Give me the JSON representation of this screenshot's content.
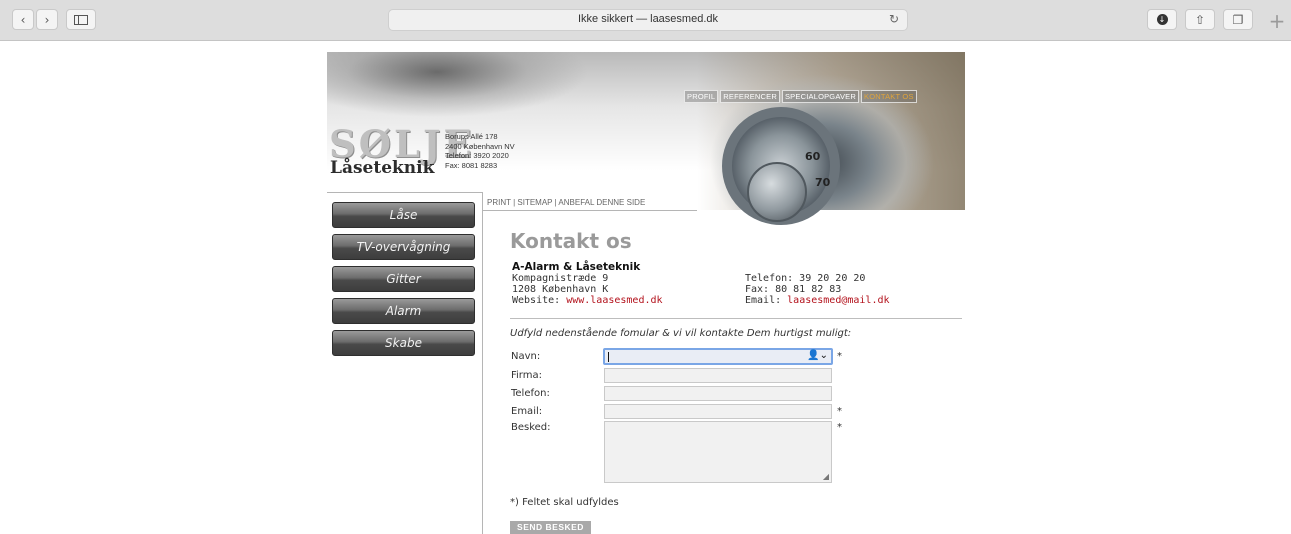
{
  "browser": {
    "address": "Ikke sikkert — laasesmed.dk"
  },
  "topnav": {
    "items": [
      "PROFIL",
      "REFERENCER",
      "SPECIALOPGAVER",
      "KONTAKT OS"
    ],
    "active_index": 3,
    "active_color": "#e0a43a"
  },
  "logo": {
    "line1": "SØLJE",
    "line2": "Låseteknik"
  },
  "company_address": {
    "line1": "Borups Allé 178",
    "line2": "2400 København NV",
    "line3": "Telefon: 3920 2020",
    "line4": "Fax: 8081 8283"
  },
  "sub_links": "PRINT | SITEMAP | ANBEFAL DENNE SIDE",
  "menu": {
    "items": [
      "Låse",
      "TV-overvågning",
      "Gitter",
      "Alarm",
      "Skabe"
    ]
  },
  "page": {
    "title": "Kontakt os",
    "company": "A-Alarm & Låseteknik",
    "street": "Kompagnistræde 9",
    "city": "1208 København K",
    "website_label": "Website:",
    "website": "www.laasesmed.dk",
    "phone": "Telefon: 39 20 20 20",
    "fax": "Fax: 80 81 82 83",
    "email_label": "Email:",
    "email": "laasesmed@mail.dk",
    "link_color": "#b3121c",
    "intro": "Udfyld nedenstående fomular & vi vil kontakte Dem hurtigst muligt:"
  },
  "form": {
    "name_label": "Navn:",
    "company_label": "Firma:",
    "phone_label": "Telefon:",
    "email_label": "Email:",
    "message_label": "Besked:",
    "required_mark": "*",
    "required_note": "*) Feltet skal udfyldes",
    "submit_label": "SEND BESKED",
    "name_value": "",
    "company_value": "",
    "phone_value": "",
    "email_value": "",
    "message_value": ""
  },
  "dial": {
    "numbers": [
      "60",
      "70"
    ]
  }
}
